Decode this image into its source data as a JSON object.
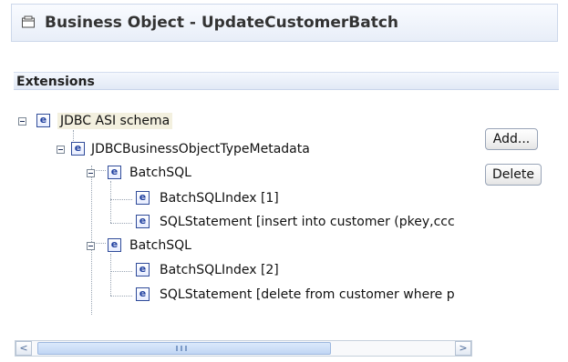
{
  "header": {
    "title": "Business Object - UpdateCustomerBatch",
    "icon": "business-object-icon"
  },
  "extensions": {
    "section_title": "Extensions",
    "tree_items": [
      {
        "label": "JDBC ASI schema",
        "icon": "e-icon",
        "expanded": true,
        "selected": true
      },
      {
        "label": "JDBCBusinessObjectTypeMetadata",
        "icon": "e-icon",
        "expanded": true
      },
      {
        "label": "BatchSQL",
        "icon": "e-icon",
        "expanded": true
      },
      {
        "label": "BatchSQLIndex [1]",
        "icon": "e-icon"
      },
      {
        "label": "SQLStatement [insert into customer (pkey,ccc",
        "icon": "e-icon"
      },
      {
        "label": "BatchSQL",
        "icon": "e-icon",
        "expanded": true
      },
      {
        "label": "BatchSQLIndex [2]",
        "icon": "e-icon"
      },
      {
        "label": "SQLStatement [delete from customer where p",
        "icon": "e-icon"
      }
    ]
  },
  "actions": {
    "add_label": "Add...",
    "delete_label": "Delete"
  },
  "scrollbar": {
    "left_arrow": "<",
    "right_arrow": ">"
  },
  "icons": {
    "element": "e"
  },
  "colors": {
    "selection": "#f3f0df",
    "element_icon": "#1f3f9e"
  }
}
